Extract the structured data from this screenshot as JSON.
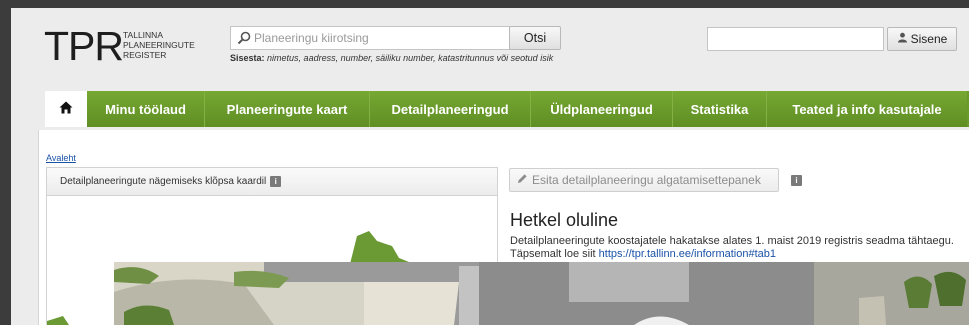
{
  "logo": {
    "text": "TPR",
    "subtitle_lines": [
      "TALLINNA",
      "PLANEERINGUTE",
      "REGISTER"
    ]
  },
  "search": {
    "placeholder": "Planeeringu kiirotsing",
    "button_label": "Otsi",
    "hint_label": "Sisesta:",
    "hint_text": "nimetus, aadress, number, säiliku number, katastritunnus või seotud isik"
  },
  "login": {
    "button_label": "Sisene"
  },
  "nav": {
    "items": [
      {
        "label": "Minu töölaud"
      },
      {
        "label": "Planeeringute kaart"
      },
      {
        "label": "Detailplaneeringud"
      },
      {
        "label": "Üldplaneeringud"
      },
      {
        "label": "Statistika"
      },
      {
        "label": "Teated ja info kasutajale"
      }
    ]
  },
  "breadcrumb": {
    "home": "Avaleht"
  },
  "map_panel": {
    "header": "Detailplaneeringute nägemiseks klõpsa kaardil",
    "info_glyph": "i"
  },
  "actions": {
    "submit_label": "Esita detailplaneeringu algatamisettepanek",
    "info_glyph": "i"
  },
  "news": {
    "title": "Hetkel oluline",
    "text": "Detailplaneeringute koostajatele hakatakse alates 1. maist 2019 registris seadma tähtaegu. Täpsemalt loe siit",
    "link": "https://tpr.tallinn.ee/information#tab1"
  },
  "colors": {
    "nav_green": "#6a9a2b",
    "map_green": "#6b9a35",
    "link_blue": "#1a52a8"
  },
  "icons": {
    "search": "magnifier-icon",
    "login": "user-icon",
    "home": "house-icon",
    "submit": "pencil-icon",
    "info": "info-icon"
  }
}
